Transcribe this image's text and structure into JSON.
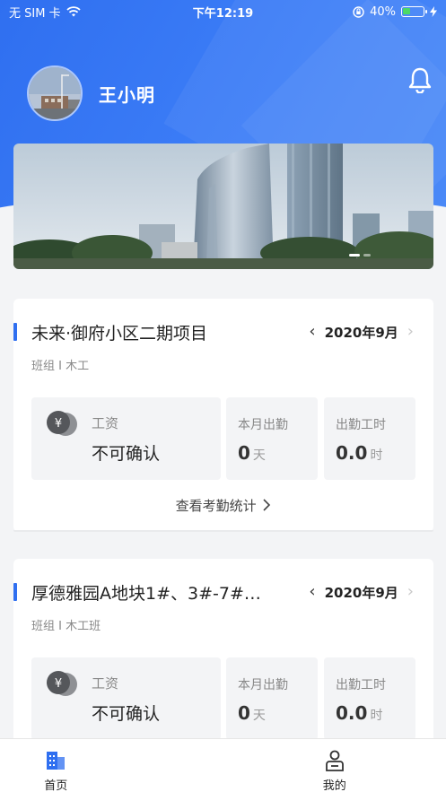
{
  "status_bar": {
    "carrier": "无 SIM 卡",
    "time": "下午12:19",
    "battery": "40%",
    "battery_level": 0.4
  },
  "header": {
    "username": "王小明"
  },
  "colors": {
    "primary": "#2f6ff0",
    "accent_bar": "#2f6ff0"
  },
  "projects": [
    {
      "title": "未来·御府小区二期项目",
      "month": "2020年9月",
      "team": "班组 I 木工",
      "wage_label": "工资",
      "wage_value": "不可确认",
      "attendance_label": "本月出勤",
      "attendance_value": "0",
      "attendance_unit": "天",
      "hours_label": "出勤工时",
      "hours_value": "0.0",
      "hours_unit": "时",
      "view_link": "查看考勤统计"
    },
    {
      "title": "厚德雅园A地块1#、3#-7#…",
      "month": "2020年9月",
      "team": "班组 I 木工班",
      "wage_label": "工资",
      "wage_value": "不可确认",
      "attendance_label": "本月出勤",
      "attendance_value": "0",
      "attendance_unit": "天",
      "hours_label": "出勤工时",
      "hours_value": "0.0",
      "hours_unit": "时"
    }
  ],
  "tabbar": {
    "home_label": "首页",
    "mine_label": "我的"
  },
  "icons": {
    "bell": "bell-icon",
    "home": "building-icon",
    "mine": "person-icon",
    "coin": "yuan-coin-icon",
    "wifi": "wifi-icon",
    "lock": "rotation-lock-icon",
    "charge": "charging-icon"
  }
}
